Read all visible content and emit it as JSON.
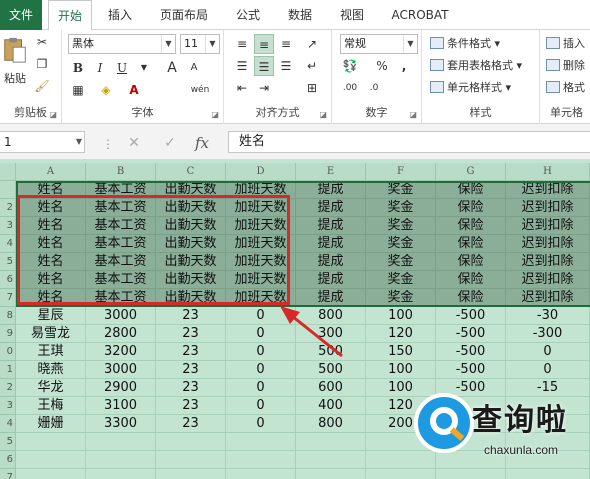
{
  "tabs": [
    {
      "label": "文件"
    },
    {
      "label": "开始"
    },
    {
      "label": "插入"
    },
    {
      "label": "页面布局"
    },
    {
      "label": "公式"
    },
    {
      "label": "数据"
    },
    {
      "label": "视图"
    },
    {
      "label": "ACROBAT"
    }
  ],
  "ribbon": {
    "clipboard": {
      "paste_label": "粘贴",
      "group_label": "剪贴板"
    },
    "font": {
      "name": "黑体",
      "size": "11",
      "group_label": "字体",
      "bold": "B",
      "italic": "I",
      "underline": "U",
      "grow": "A",
      "shrink": "A",
      "phonetic": "wén"
    },
    "alignment": {
      "group_label": "对齐方式"
    },
    "number": {
      "format": "常规",
      "group_label": "数字",
      "percent": "%",
      "comma": ","
    },
    "styles": {
      "cond_format": "条件格式",
      "table_format": "套用表格格式",
      "cell_style": "单元格样式",
      "group_label": "样式"
    },
    "cells": {
      "insert": "插入",
      "delete": "删除",
      "format": "格式",
      "group_label": "单元格"
    }
  },
  "formula_bar": {
    "name_box": "1",
    "cancel": "✕",
    "enter": "✓",
    "fx": "fx",
    "content": "姓名"
  },
  "columns": [
    "A",
    "B",
    "C",
    "D",
    "E",
    "F",
    "G",
    "H"
  ],
  "row_numbers": [
    "",
    "2",
    "3",
    "4",
    "5",
    "6",
    "7",
    "8",
    "9",
    "0",
    "1",
    "2",
    "3",
    "4",
    "5",
    "6",
    "7"
  ],
  "rows": [
    [
      "姓名",
      "基本工资",
      "出勤天数",
      "加班天数",
      "提成",
      "奖金",
      "保险",
      "迟到扣除"
    ],
    [
      "姓名",
      "基本工资",
      "出勤天数",
      "加班天数",
      "提成",
      "奖金",
      "保险",
      "迟到扣除"
    ],
    [
      "姓名",
      "基本工资",
      "出勤天数",
      "加班天数",
      "提成",
      "奖金",
      "保险",
      "迟到扣除"
    ],
    [
      "姓名",
      "基本工资",
      "出勤天数",
      "加班天数",
      "提成",
      "奖金",
      "保险",
      "迟到扣除"
    ],
    [
      "姓名",
      "基本工资",
      "出勤天数",
      "加班天数",
      "提成",
      "奖金",
      "保险",
      "迟到扣除"
    ],
    [
      "姓名",
      "基本工资",
      "出勤天数",
      "加班天数",
      "提成",
      "奖金",
      "保险",
      "迟到扣除"
    ],
    [
      "姓名",
      "基本工资",
      "出勤天数",
      "加班天数",
      "提成",
      "奖金",
      "保险",
      "迟到扣除"
    ],
    [
      "星辰",
      "3000",
      "23",
      "0",
      "800",
      "100",
      "-500",
      "-30"
    ],
    [
      "易雪龙",
      "2800",
      "23",
      "0",
      "300",
      "120",
      "-500",
      "-300"
    ],
    [
      "王琪",
      "3200",
      "23",
      "0",
      "500",
      "150",
      "-500",
      "0"
    ],
    [
      "晓燕",
      "3000",
      "23",
      "0",
      "500",
      "100",
      "-500",
      "0"
    ],
    [
      "华龙",
      "2900",
      "23",
      "0",
      "600",
      "100",
      "-500",
      "-15"
    ],
    [
      "王梅",
      "3100",
      "23",
      "0",
      "400",
      "120",
      "",
      ""
    ],
    [
      "姗姗",
      "3300",
      "23",
      "0",
      "800",
      "200",
      "",
      ""
    ],
    [
      "",
      "",
      "",
      "",
      "",
      "",
      "",
      ""
    ],
    [
      "",
      "",
      "",
      "",
      "",
      "",
      "",
      ""
    ],
    [
      "",
      "",
      "",
      "",
      "",
      "",
      "",
      ""
    ]
  ],
  "watermark": {
    "title": "查询啦",
    "url": "chaxunla.com"
  },
  "colors": {
    "accent": "#217346",
    "highlight_box": "#d7282a",
    "grid_bg": "#c4e4d2",
    "selection": "#8aae97"
  }
}
